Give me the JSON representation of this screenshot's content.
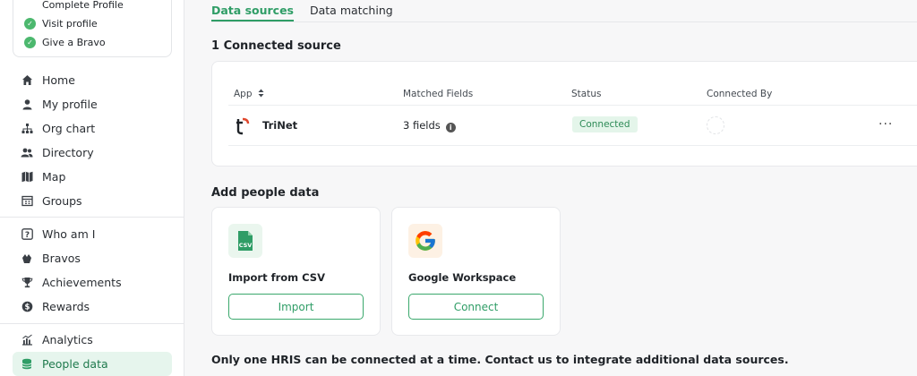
{
  "sidebar": {
    "checklist": [
      {
        "label": "Complete Profile",
        "done": false
      },
      {
        "label": "Visit profile",
        "done": true
      },
      {
        "label": "Give a Bravo",
        "done": true
      }
    ],
    "nav_main": [
      {
        "label": "Home",
        "icon": "home-icon"
      },
      {
        "label": "My profile",
        "icon": "user-icon"
      },
      {
        "label": "Org chart",
        "icon": "org-chart-icon"
      },
      {
        "label": "Directory",
        "icon": "users-icon"
      },
      {
        "label": "Map",
        "icon": "map-icon"
      },
      {
        "label": "Groups",
        "icon": "groups-icon"
      }
    ],
    "nav_engage": [
      {
        "label": "Who am I",
        "icon": "question-icon"
      },
      {
        "label": "Bravos",
        "icon": "hands-icon"
      },
      {
        "label": "Achievements",
        "icon": "trophy-icon"
      },
      {
        "label": "Rewards",
        "icon": "dollar-icon"
      }
    ],
    "nav_admin": [
      {
        "label": "Analytics",
        "icon": "chart-icon",
        "active": false
      },
      {
        "label": "People data",
        "icon": "database-icon",
        "active": true
      }
    ]
  },
  "tabs": [
    {
      "label": "Data sources",
      "active": true
    },
    {
      "label": "Data matching",
      "active": false
    }
  ],
  "connected": {
    "title": "1 Connected source",
    "columns": {
      "app": "App",
      "matched": "Matched Fields",
      "status": "Status",
      "connected_by": "Connected By"
    },
    "sort_icon": "sort-icon",
    "rows": [
      {
        "app": "TriNet",
        "matched": "3 fields",
        "status": "Connected"
      }
    ]
  },
  "add_people": {
    "title": "Add people data",
    "tiles": [
      {
        "title": "Import from CSV",
        "button": "Import",
        "icon": "csv-file-icon",
        "icon_text": "CSV"
      },
      {
        "title": "Google Workspace",
        "button": "Connect",
        "icon": "google-icon"
      }
    ]
  },
  "footer_note": "Only one HRIS can be connected at a time. Contact us to integrate additional data sources.",
  "colors": {
    "accent": "#2f9d66",
    "accent_bg": "#e6f5ed",
    "status_bg": "#e4f5ea",
    "trinet": "#e0482e"
  }
}
